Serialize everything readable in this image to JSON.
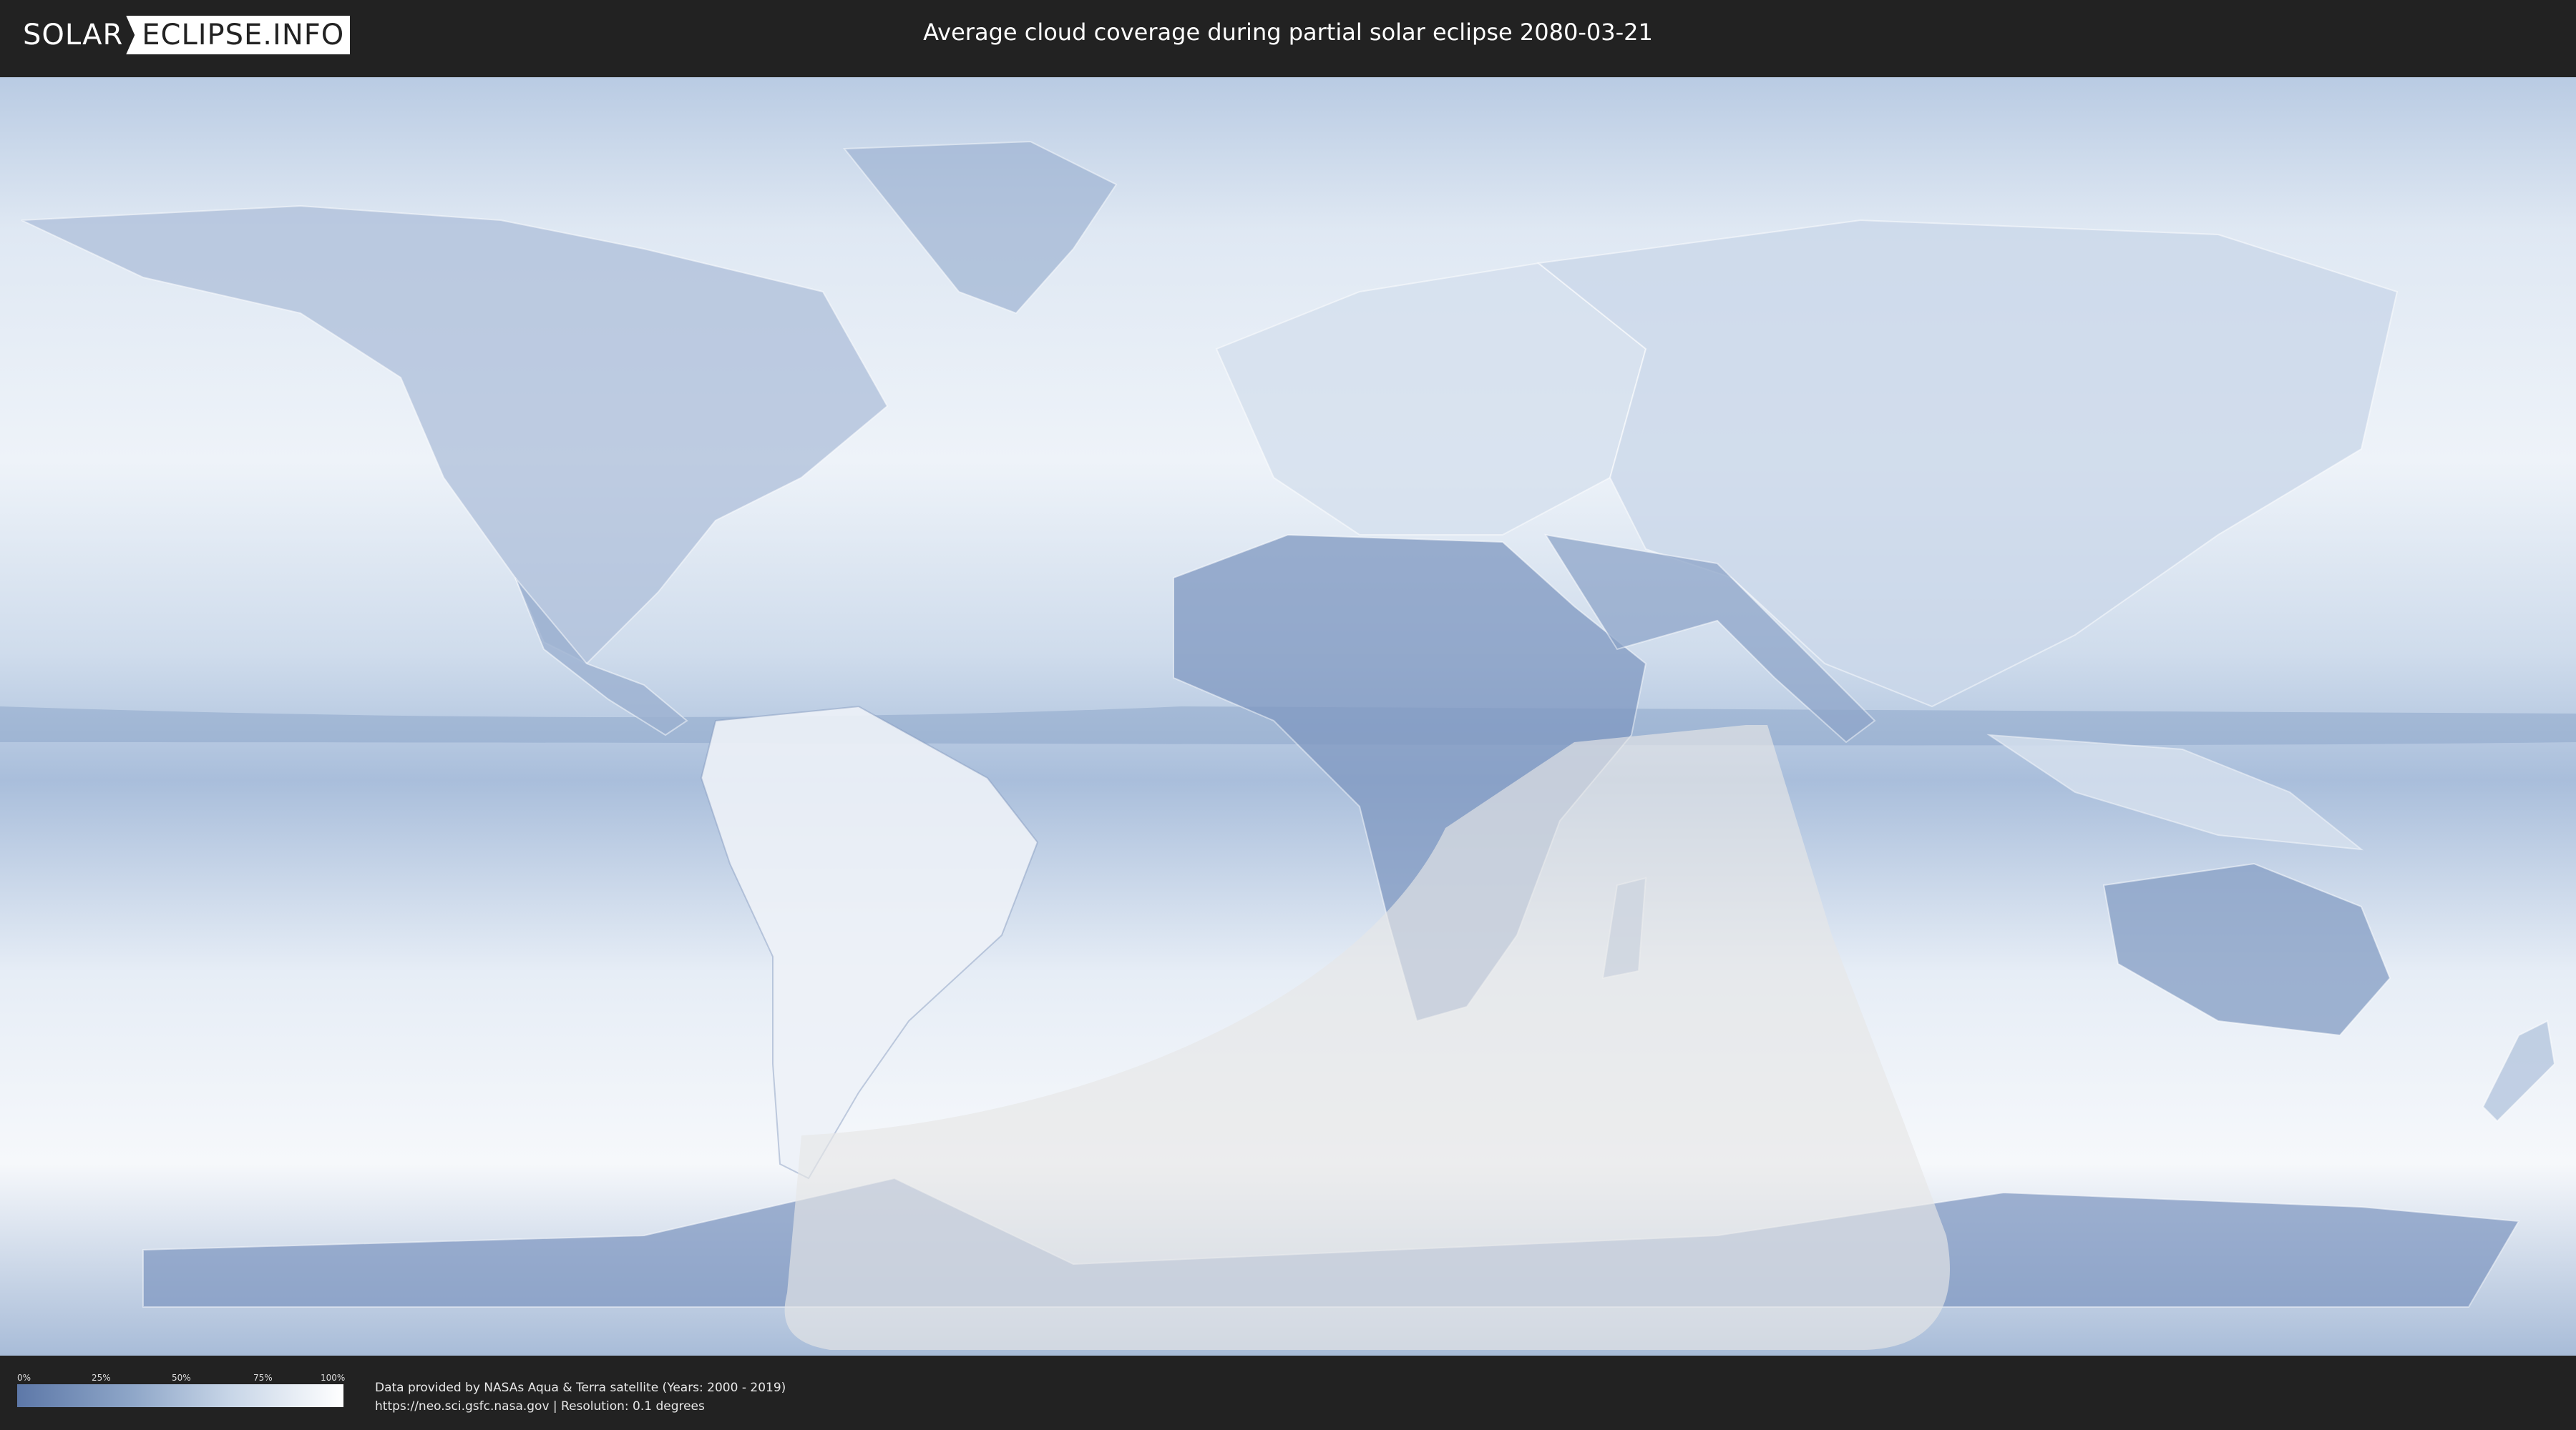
{
  "header": {
    "logo_part1": "SOLAR",
    "logo_part2": "ECLIPSE.INFO",
    "title": "Average cloud coverage during partial solar eclipse 2080-03-21"
  },
  "legend": {
    "ticks": [
      "0%",
      "25%",
      "50%",
      "75%",
      "100%"
    ],
    "colors": {
      "low": "#5d78a8",
      "mid": "#c7d5e7",
      "high": "#ffffff"
    }
  },
  "credits": {
    "line1": "Data provided by NASAs Aqua & Terra satellite (Years: 2000 - 2019)",
    "line2": "https://neo.sci.gsfc.nasa.gov | Resolution: 0.1 degrees"
  },
  "map": {
    "cloud_color_low": "#5d78a8",
    "cloud_color_high": "#ffffff",
    "eclipse_overlay_color": "#e6e6e6"
  }
}
